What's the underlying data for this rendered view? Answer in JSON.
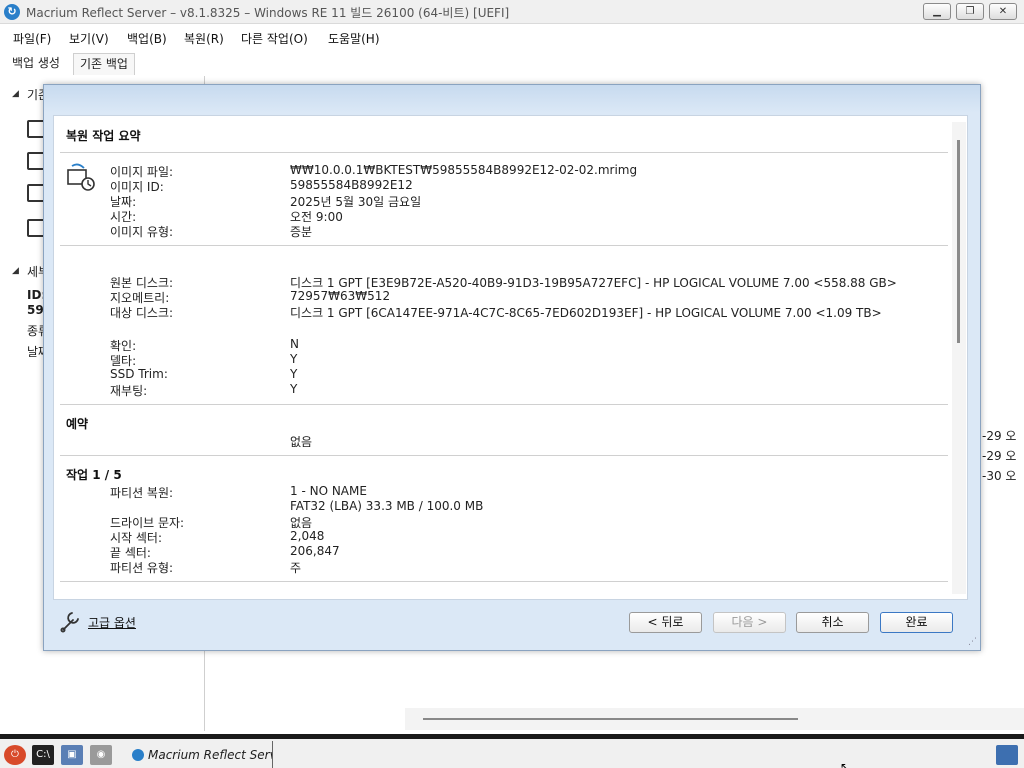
{
  "window": {
    "title": "Macrium Reflect Server – v8.1.8325 – Windows RE 11 빌드 26100 (64-비트)  [UEFI]",
    "minimize_icon": "minimize-icon",
    "maximize_icon": "restore-icon",
    "close_icon": "close-icon"
  },
  "menu": [
    "파일(F)",
    "보기(V)",
    "백업(B)",
    "복원(R)",
    "다른 작업(O)",
    "도움말(H)"
  ],
  "tabs": [
    "백업 생성",
    "기존 백업"
  ],
  "left_panel": {
    "section1": "기존",
    "section2": "세부",
    "id_label": "ID:",
    "id_value": "59",
    "type_label": "종류",
    "date_label": "날짜"
  },
  "right_strip": [
    "-29 오",
    "-29 오",
    "-30 오"
  ],
  "dialog": {
    "summary_title": "복원 작업 요약",
    "image_info": [
      {
        "label": "이미지 파일:",
        "value": "₩₩10.0.0.1₩BKTEST₩59855584B8992E12-02-02.mrimg"
      },
      {
        "label": "이미지 ID:",
        "value": "59855584B8992E12"
      },
      {
        "label": "날짜:",
        "value": "2025년 5월 30일 금요일"
      },
      {
        "label": "시간:",
        "value": "오전 9:00"
      },
      {
        "label": "이미지 유형:",
        "value": "증분"
      }
    ],
    "disk_info": [
      {
        "label": "원본 디스크:",
        "value": "디스크 1 GPT [E3E9B72E-A520-40B9-91D3-19B95A727EFC] - HP       LOGICAL VOLUME   7.00  <558.88 GB>"
      },
      {
        "label": "지오메트리:",
        "value": "72957₩63₩512"
      },
      {
        "label": "대상 디스크:",
        "value": "디스크 1 GPT [6CA147EE-971A-4C7C-8C65-7ED602D193EF] - HP       LOGICAL VOLUME   7.00  <1.09 TB>"
      }
    ],
    "flags": [
      {
        "label": "확인:",
        "value": "N"
      },
      {
        "label": "델타:",
        "value": "Y"
      },
      {
        "label": "SSD Trim:",
        "value": "Y"
      },
      {
        "label": "재부팅:",
        "value": "Y"
      }
    ],
    "schedule_title": "예약",
    "schedule_value": "없음",
    "operation_title": "작업 1 / 5",
    "operation": [
      {
        "label": "파티션 복원:",
        "value": "1 - NO NAME"
      },
      {
        "label": "",
        "value": "FAT32 (LBA) 33.3 MB / 100.0 MB"
      },
      {
        "label": "드라이브 문자:",
        "value": "없음"
      },
      {
        "label": "시작 섹터:",
        "value": "2,048"
      },
      {
        "label": "끝 섹터:",
        "value": "206,847"
      },
      {
        "label": "파티션 유형:",
        "value": "주"
      }
    ],
    "advanced_link": "고급 옵션",
    "buttons": {
      "back": "< 뒤로",
      "next": "다음 >",
      "cancel": "취소",
      "finish": "완료"
    }
  },
  "taskbar": {
    "task_label": "Macrium Reflect Serv...",
    "icons": [
      "power-icon",
      "cmd-icon",
      "network-icon",
      "camera-icon",
      "tray-app-icon"
    ]
  }
}
